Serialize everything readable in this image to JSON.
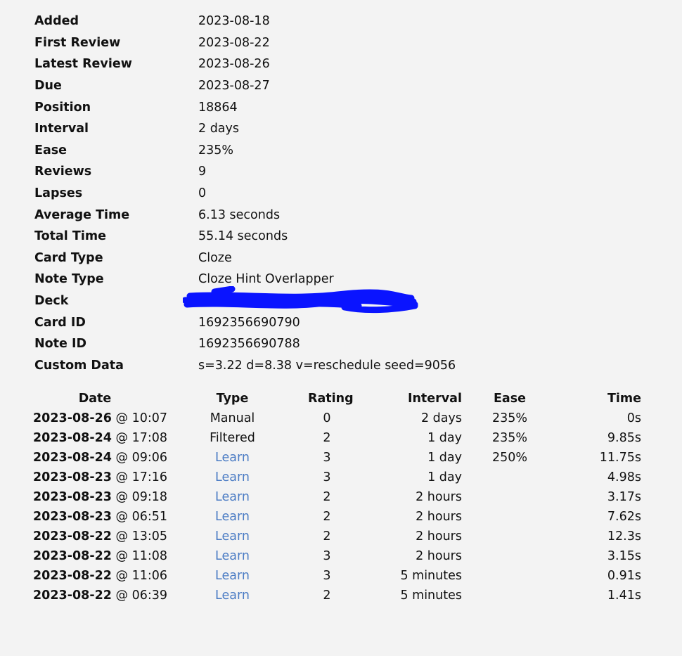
{
  "card_info": [
    {
      "label": "Added",
      "value": "2023-08-18"
    },
    {
      "label": "First Review",
      "value": "2023-08-22"
    },
    {
      "label": "Latest Review",
      "value": "2023-08-26"
    },
    {
      "label": "Due",
      "value": "2023-08-27"
    },
    {
      "label": "Position",
      "value": "18864"
    },
    {
      "label": "Interval",
      "value": "2 days"
    },
    {
      "label": "Ease",
      "value": "235%"
    },
    {
      "label": "Reviews",
      "value": "9"
    },
    {
      "label": "Lapses",
      "value": "0"
    },
    {
      "label": "Average Time",
      "value": "6.13 seconds"
    },
    {
      "label": "Total Time",
      "value": "55.14 seconds"
    },
    {
      "label": "Card Type",
      "value": "Cloze"
    },
    {
      "label": "Note Type",
      "value": "Cloze Hint Overlapper"
    },
    {
      "label": "Deck",
      "value": ""
    },
    {
      "label": "Card ID",
      "value": "1692356690790"
    },
    {
      "label": "Note ID",
      "value": "1692356690788"
    },
    {
      "label": "Custom Data",
      "value": "s=3.22 d=8.38 v=reschedule seed=9056"
    }
  ],
  "colors": {
    "background": "#f3f3f3",
    "learn_link": "#4b7cc4",
    "redaction": "#0a14ff"
  },
  "revlog": {
    "headers": {
      "date": "Date",
      "type": "Type",
      "rating": "Rating",
      "interval": "Interval",
      "ease": "Ease",
      "time": "Time"
    },
    "rows": [
      {
        "date": "2023-08-26",
        "time_of_day": "@ 10:07",
        "type": "Manual",
        "rating": "0",
        "interval": "2 days",
        "ease": "235%",
        "time": "0s"
      },
      {
        "date": "2023-08-24",
        "time_of_day": "@ 17:08",
        "type": "Filtered",
        "rating": "2",
        "interval": "1 day",
        "ease": "235%",
        "time": "9.85s"
      },
      {
        "date": "2023-08-24",
        "time_of_day": "@ 09:06",
        "type": "Learn",
        "rating": "3",
        "interval": "1 day",
        "ease": "250%",
        "time": "11.75s"
      },
      {
        "date": "2023-08-23",
        "time_of_day": "@ 17:16",
        "type": "Learn",
        "rating": "3",
        "interval": "1 day",
        "ease": "",
        "time": "4.98s"
      },
      {
        "date": "2023-08-23",
        "time_of_day": "@ 09:18",
        "type": "Learn",
        "rating": "2",
        "interval": "2 hours",
        "ease": "",
        "time": "3.17s"
      },
      {
        "date": "2023-08-23",
        "time_of_day": "@ 06:51",
        "type": "Learn",
        "rating": "2",
        "interval": "2 hours",
        "ease": "",
        "time": "7.62s"
      },
      {
        "date": "2023-08-22",
        "time_of_day": "@ 13:05",
        "type": "Learn",
        "rating": "2",
        "interval": "2 hours",
        "ease": "",
        "time": "12.3s"
      },
      {
        "date": "2023-08-22",
        "time_of_day": "@ 11:08",
        "type": "Learn",
        "rating": "3",
        "interval": "2 hours",
        "ease": "",
        "time": "3.15s"
      },
      {
        "date": "2023-08-22",
        "time_of_day": "@ 11:06",
        "type": "Learn",
        "rating": "3",
        "interval": "5 minutes",
        "ease": "",
        "time": "0.91s"
      },
      {
        "date": "2023-08-22",
        "time_of_day": "@ 06:39",
        "type": "Learn",
        "rating": "2",
        "interval": "5 minutes",
        "ease": "",
        "time": "1.41s"
      }
    ]
  }
}
